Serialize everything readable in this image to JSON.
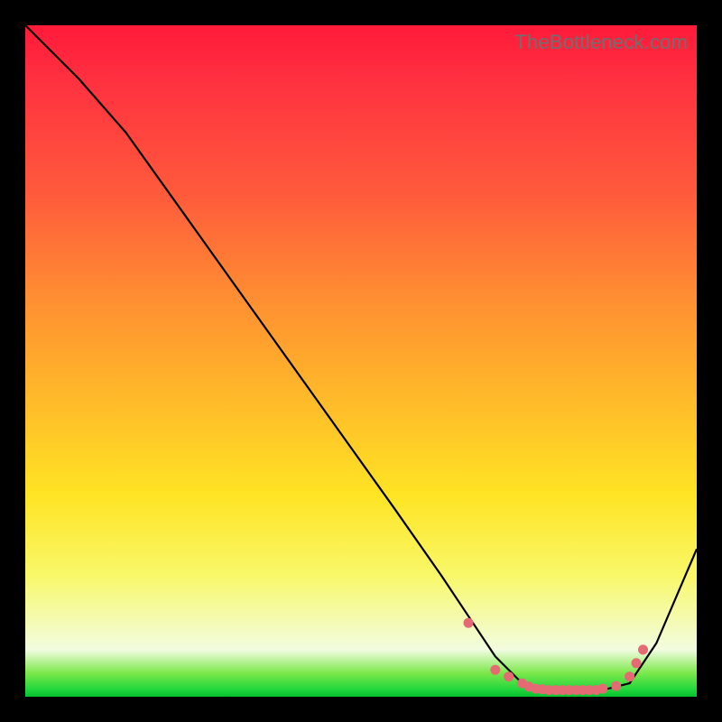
{
  "watermark": "TheBottleneck.com",
  "chart_data": {
    "type": "line",
    "title": "",
    "xlabel": "",
    "ylabel": "",
    "xlim": [
      0,
      100
    ],
    "ylim": [
      0,
      100
    ],
    "note": "Axes are unlabeled in the source image; x and y are normalized 0–100 across the plot area. y-values approximate the vertical position of the black curve (0 = bottom, 100 = top).",
    "series": [
      {
        "name": "curve",
        "x": [
          0,
          8,
          15,
          25,
          35,
          45,
          55,
          62,
          66,
          70,
          74,
          78,
          82,
          86,
          90,
          94,
          100
        ],
        "y": [
          100,
          92,
          84,
          70,
          56,
          42,
          28,
          18,
          12,
          6,
          2,
          1,
          1,
          1,
          2,
          8,
          22
        ]
      }
    ],
    "markers": {
      "name": "dots",
      "note": "Cluster of pink dots along the curve near the bottom valley region.",
      "x": [
        66,
        70,
        72,
        74,
        75,
        76,
        77,
        78,
        79,
        80,
        81,
        82,
        83,
        84,
        85,
        86,
        88,
        90,
        91,
        92
      ],
      "y": [
        11,
        4,
        3,
        2,
        1.5,
        1.2,
        1.1,
        1,
        1,
        1,
        1,
        1,
        1,
        1,
        1,
        1.2,
        1.6,
        3,
        5,
        7
      ]
    }
  }
}
